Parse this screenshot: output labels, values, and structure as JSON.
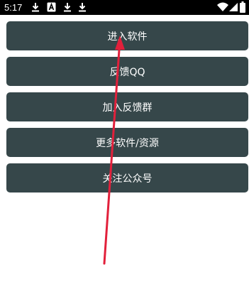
{
  "status_bar": {
    "time": "5:17",
    "icons": [
      "download-icon",
      "a-letter-icon",
      "download-icon",
      "download-icon",
      "wifi-icon",
      "signal-icon",
      "battery-icon"
    ]
  },
  "menu": {
    "items": [
      {
        "label": "进入软件"
      },
      {
        "label": "反馈QQ"
      },
      {
        "label": "加入反馈群"
      },
      {
        "label": "更多软件/资源"
      },
      {
        "label": "关注公众号"
      }
    ],
    "button_color": "#36474a"
  },
  "annotation": {
    "arrow_color": "#e2203b"
  }
}
